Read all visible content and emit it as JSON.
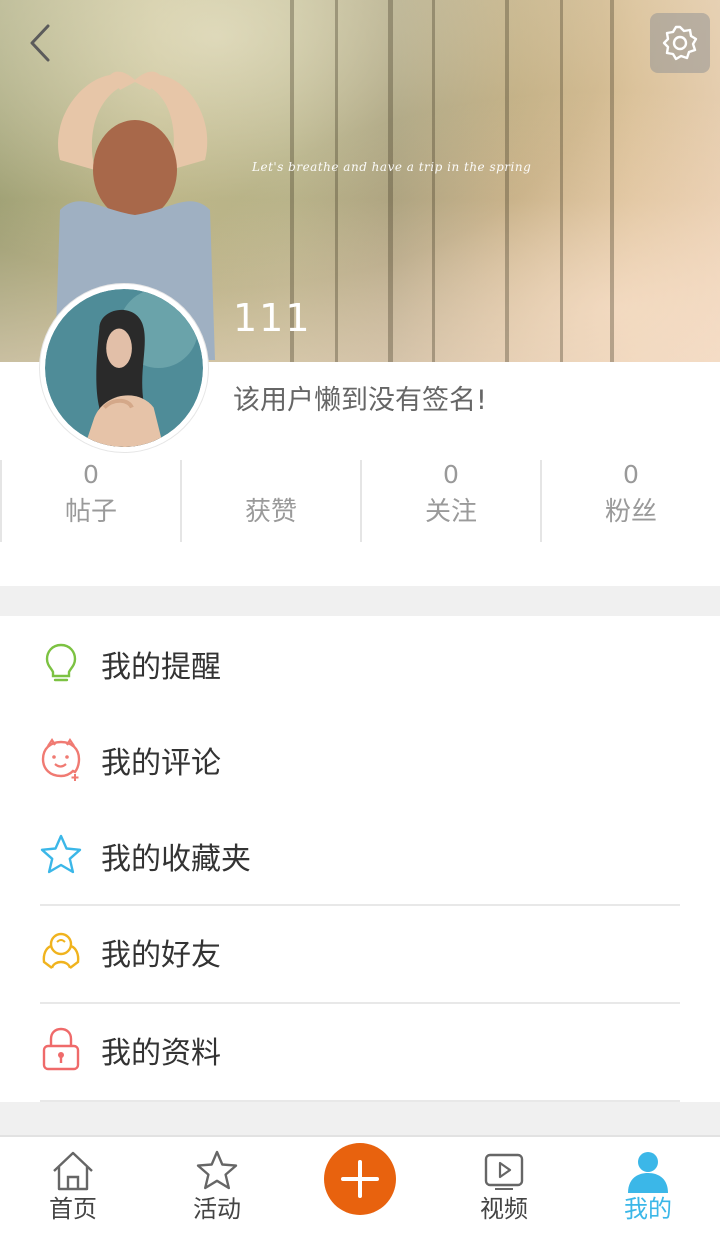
{
  "banner": {
    "tagline": "Let's breathe and have a trip in the spring",
    "username": "111"
  },
  "profile": {
    "signature": "该用户懒到没有签名!",
    "stats": [
      {
        "value": "0",
        "label": "帖子"
      },
      {
        "value": "",
        "label": "获赞"
      },
      {
        "value": "0",
        "label": "关注"
      },
      {
        "value": "0",
        "label": "粉丝"
      }
    ]
  },
  "menu": {
    "items": [
      {
        "label": "我的提醒",
        "icon": "lightbulb-icon",
        "color": "#7cc242"
      },
      {
        "label": "我的评论",
        "icon": "smiley-face-icon",
        "color": "#f07a72"
      },
      {
        "label": "我的收藏夹",
        "icon": "star-icon",
        "color": "#3bb7e8"
      },
      {
        "label": "我的好友",
        "icon": "friends-icon",
        "color": "#f0b31e"
      },
      {
        "label": "我的资料",
        "icon": "lock-icon",
        "color": "#ef6a6a"
      }
    ]
  },
  "tabbar": {
    "tabs": [
      {
        "label": "首页",
        "icon": "home-icon"
      },
      {
        "label": "活动",
        "icon": "star-outline-icon"
      },
      {
        "label": "",
        "icon": "plus-icon"
      },
      {
        "label": "视频",
        "icon": "video-icon"
      },
      {
        "label": "我的",
        "icon": "person-icon"
      }
    ],
    "active_color": "#3bb7e8",
    "plus_color": "#e8620e"
  }
}
